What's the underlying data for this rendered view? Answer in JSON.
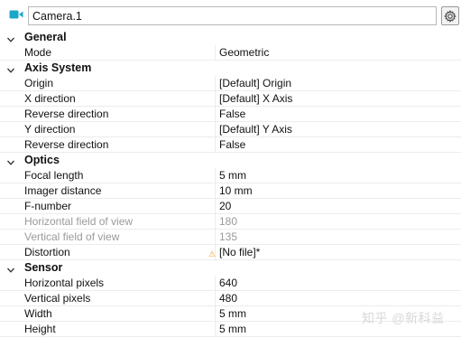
{
  "header": {
    "object_name": "Camera.1",
    "icon": "camera-icon",
    "settings_icon": "gear-icon",
    "accent_color": "#1aa7c8"
  },
  "categories": [
    {
      "id": "general",
      "label": "General",
      "expanded": true,
      "props": [
        {
          "id": "mode",
          "label": "Mode",
          "value": "Geometric",
          "enabled": true
        }
      ]
    },
    {
      "id": "axis-system",
      "label": "Axis System",
      "expanded": true,
      "props": [
        {
          "id": "origin",
          "label": "Origin",
          "value": "[Default] Origin",
          "enabled": true
        },
        {
          "id": "x-direction",
          "label": "X direction",
          "value": "[Default] X Axis",
          "enabled": true
        },
        {
          "id": "reverse-direction-x",
          "label": "Reverse direction",
          "value": "False",
          "enabled": true
        },
        {
          "id": "y-direction",
          "label": "Y direction",
          "value": "[Default] Y Axis",
          "enabled": true
        },
        {
          "id": "reverse-direction-y",
          "label": "Reverse direction",
          "value": "False",
          "enabled": true
        }
      ]
    },
    {
      "id": "optics",
      "label": "Optics",
      "expanded": true,
      "props": [
        {
          "id": "focal-length",
          "label": "Focal length",
          "value": "5 mm",
          "enabled": true
        },
        {
          "id": "imager-distance",
          "label": "Imager distance",
          "value": "10 mm",
          "enabled": true
        },
        {
          "id": "f-number",
          "label": "F-number",
          "value": "20",
          "enabled": true
        },
        {
          "id": "horizontal-fov",
          "label": "Horizontal field of view",
          "value": "180",
          "enabled": false
        },
        {
          "id": "vertical-fov",
          "label": "Vertical field of view",
          "value": "135",
          "enabled": false
        },
        {
          "id": "distortion",
          "label": "Distortion",
          "value": "[No file]*",
          "enabled": true,
          "warning_icon": "warning-icon"
        }
      ]
    },
    {
      "id": "sensor",
      "label": "Sensor",
      "expanded": true,
      "props": [
        {
          "id": "horizontal-pixels",
          "label": "Horizontal pixels",
          "value": "640",
          "enabled": true
        },
        {
          "id": "vertical-pixels",
          "label": "Vertical pixels",
          "value": "480",
          "enabled": true
        },
        {
          "id": "width",
          "label": "Width",
          "value": "5 mm",
          "enabled": true
        },
        {
          "id": "height",
          "label": "Height",
          "value": "5 mm",
          "enabled": true
        }
      ]
    }
  ],
  "watermark": "知乎 @新科益"
}
